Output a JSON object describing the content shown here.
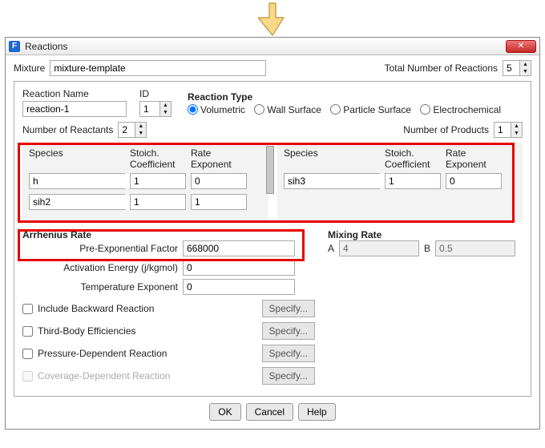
{
  "window": {
    "title": "Reactions"
  },
  "mixture": {
    "label": "Mixture",
    "value": "mixture-template"
  },
  "total_reactions": {
    "label": "Total Number of Reactions",
    "value": "5"
  },
  "reaction_name": {
    "label": "Reaction Name",
    "value": "reaction-1"
  },
  "reaction_id": {
    "label": "ID",
    "value": "1"
  },
  "reaction_type": {
    "label": "Reaction Type",
    "options": {
      "volumetric": "Volumetric",
      "wall": "Wall Surface",
      "particle": "Particle Surface",
      "electro": "Electrochemical"
    },
    "selected": "volumetric"
  },
  "num_reactants": {
    "label": "Number of Reactants",
    "value": "2"
  },
  "num_products": {
    "label": "Number of Products",
    "value": "1"
  },
  "headers": {
    "species": "Species",
    "stoich": "Stoich.\nCoefficient",
    "rate": "Rate\nExponent"
  },
  "reactants": [
    {
      "species": "h",
      "coef": "1",
      "exp": "0"
    },
    {
      "species": "sih2",
      "coef": "1",
      "exp": "1"
    }
  ],
  "products": [
    {
      "species": "sih3",
      "coef": "1",
      "exp": "0"
    }
  ],
  "arrhenius": {
    "title": "Arrhenius Rate",
    "pre_exp": {
      "label": "Pre-Exponential Factor",
      "value": "668000"
    },
    "act_energy": {
      "label": "Activation Energy (j/kgmol)",
      "value": "0"
    },
    "temp_exp": {
      "label": "Temperature Exponent",
      "value": "0"
    }
  },
  "mixing": {
    "title": "Mixing Rate",
    "A_label": "A",
    "A_value": "4",
    "B_label": "B",
    "B_value": "0.5"
  },
  "options": {
    "backward": "Include Backward Reaction",
    "thirdbody": "Third-Body Efficiencies",
    "pressure": "Pressure-Dependent Reaction",
    "coverage": "Coverage-Dependent Reaction",
    "specify": "Specify..."
  },
  "buttons": {
    "ok": "OK",
    "cancel": "Cancel",
    "help": "Help"
  }
}
